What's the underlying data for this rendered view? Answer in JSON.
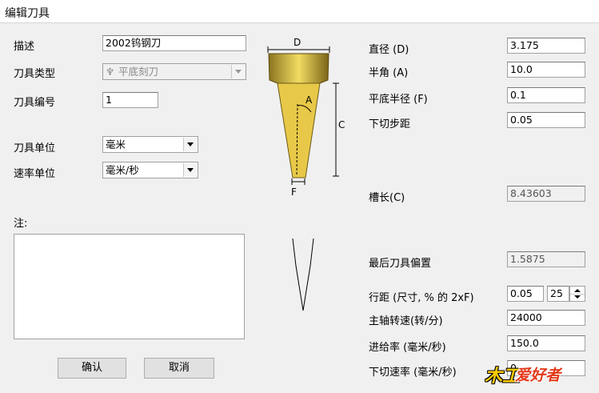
{
  "window": {
    "title": "编辑刀具"
  },
  "left": {
    "description_label": "描述",
    "description_value": "2002钨钢刀",
    "tool_type_label": "刀具类型",
    "tool_type_value": "平底刻刀",
    "tool_number_label": "刀具编号",
    "tool_number_value": "1",
    "tool_unit_label": "刀具单位",
    "tool_unit_value": "毫米",
    "rate_unit_label": "速率单位",
    "rate_unit_value": "毫米/秒",
    "note_label": "注:"
  },
  "diagram": {
    "d": "D",
    "a": "A",
    "c": "C",
    "f": "F"
  },
  "right": {
    "diameter_label": "直径 (D)",
    "diameter_value": "3.175",
    "half_angle_label": "半角 (A)",
    "half_angle_value": "10.0",
    "flat_radius_label": "平底半径 (F)",
    "flat_radius_value": "0.1",
    "stepdown_label": "下切步距",
    "stepdown_value": "0.05",
    "flute_label": "槽长(C)",
    "flute_value": "8.43603",
    "last_offset_label": "最后刀具偏置",
    "last_offset_value": "1.5875",
    "stepover_label": "行距 (尺寸, % 的 2xF)",
    "stepover_value": "0.05",
    "stepover_percent": "25",
    "spindle_label": "主轴转速(转/分)",
    "spindle_value": "24000",
    "feed_label": "进给率 (毫米/秒)",
    "feed_value": "150.0",
    "plunge_label": "下切速率 (毫米/秒)",
    "plunge_value": "0"
  },
  "buttons": {
    "ok": "确认",
    "cancel": "取消"
  },
  "watermark": {
    "text1": "木工",
    "text2": "爱好者"
  }
}
